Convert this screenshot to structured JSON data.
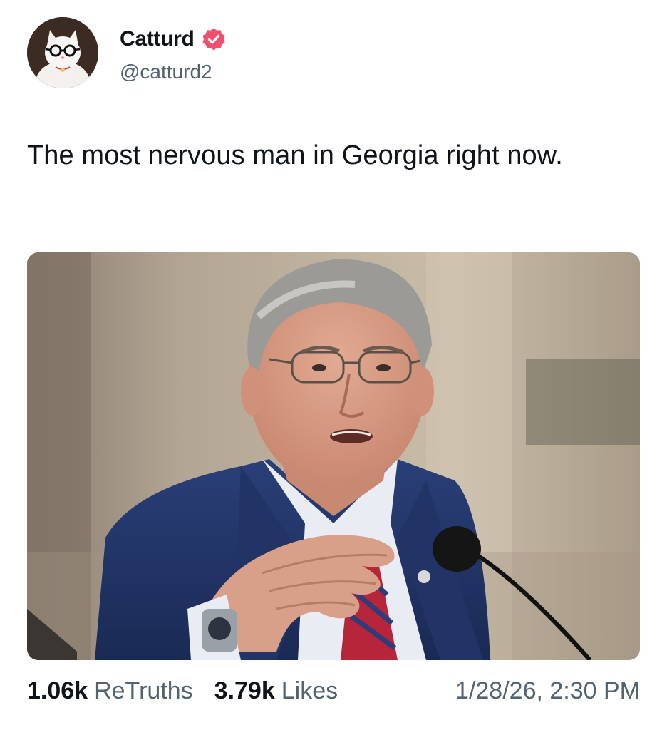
{
  "author": {
    "display_name": "Catturd",
    "handle": "@catturd2",
    "verified": true,
    "verified_badge_color": "#f0506e",
    "avatar_icon": "cat-with-glasses-avatar"
  },
  "post": {
    "text": "The most nervous man in Georgia right now.",
    "media_description_icon": "photo"
  },
  "stats": {
    "retruths_count": "1.06k",
    "retruths_label": "ReTruths",
    "likes_count": "3.79k",
    "likes_label": "Likes",
    "timestamp": "1/28/26, 2:30 PM"
  },
  "colors": {
    "text_primary": "#0f1419",
    "text_secondary": "#536471",
    "background": "#ffffff"
  }
}
